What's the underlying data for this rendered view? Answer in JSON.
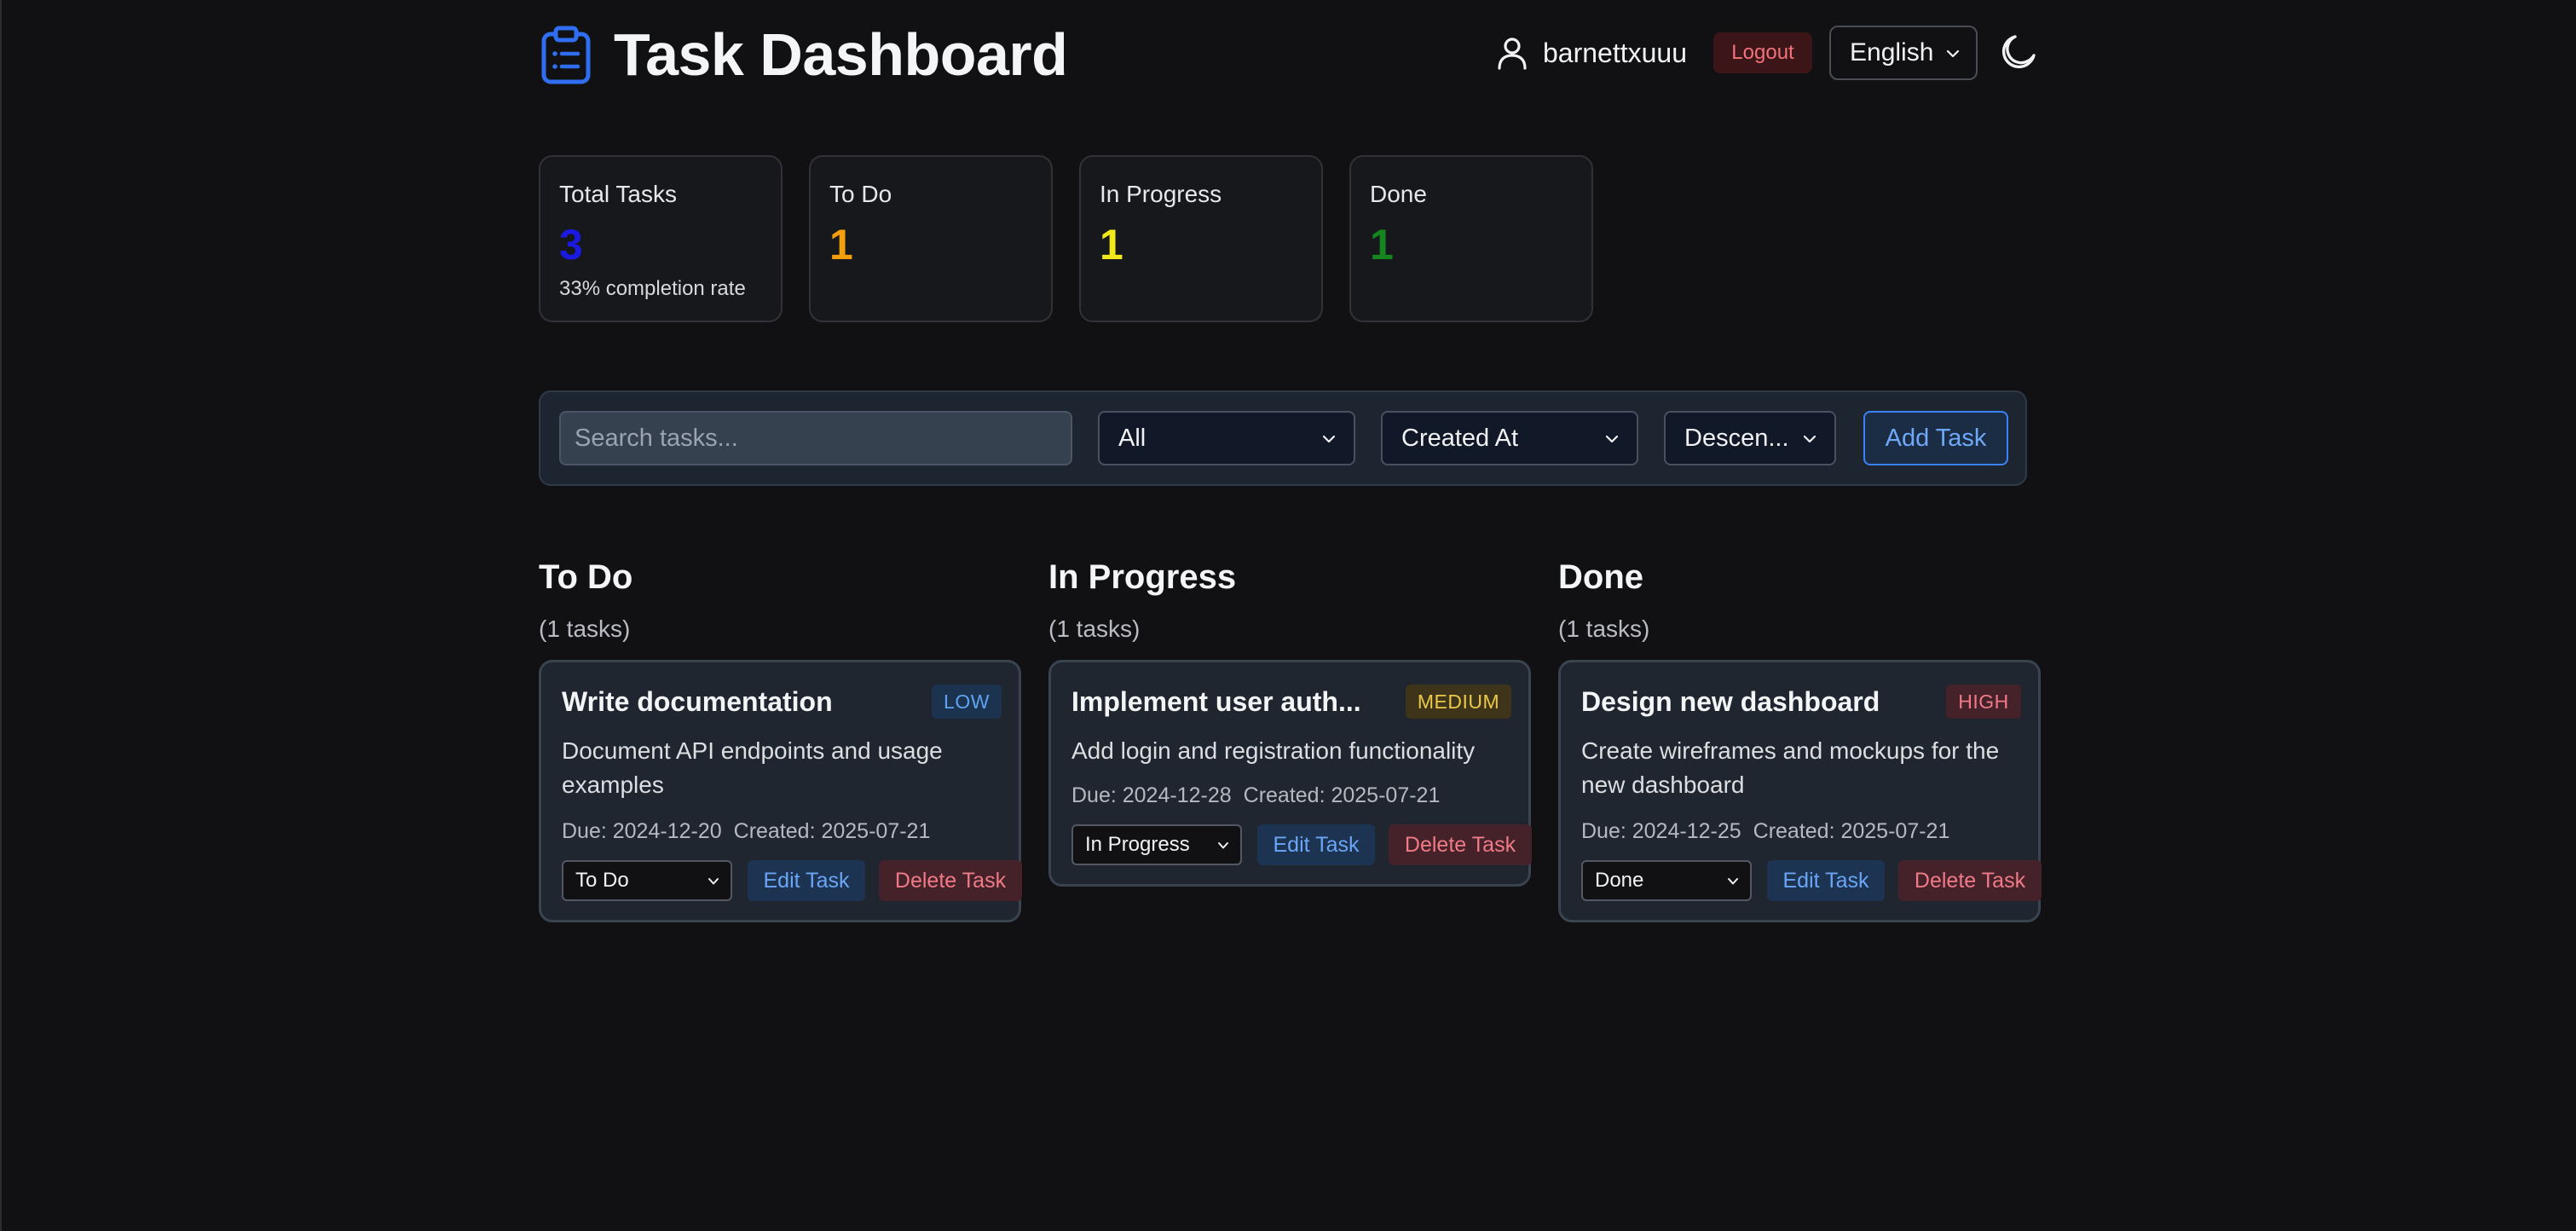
{
  "header": {
    "title": "Task Dashboard",
    "username": "barnettxuuu",
    "logout_label": "Logout",
    "language": "English",
    "logo_icon": "clipboard-list-icon",
    "user_icon": "user-icon",
    "theme_icon": "moon-icon"
  },
  "stats": [
    {
      "label": "Total Tasks",
      "value": "3",
      "sub": "33% completion rate",
      "color": "#1a1ae0"
    },
    {
      "label": "To Do",
      "value": "1",
      "color": "#f59e0b"
    },
    {
      "label": "In Progress",
      "value": "1",
      "color": "#f0e81a"
    },
    {
      "label": "Done",
      "value": "1",
      "color": "#15861f"
    }
  ],
  "toolbar": {
    "search_placeholder": "Search tasks...",
    "priority_filter": "All",
    "sort_by": "Created At",
    "sort_order": "Descen...",
    "add_label": "Add Task"
  },
  "columns": [
    {
      "title": "To Do",
      "count": "(1 tasks)",
      "card": {
        "title": "Write documentation",
        "priority": "LOW",
        "description": "Document API endpoints and usage examples",
        "due": "Due: 2024-12-20",
        "created": "Created: 2025-07-21",
        "status": "To Do",
        "edit_label": "Edit Task",
        "delete_label": "Delete Task"
      }
    },
    {
      "title": "In Progress",
      "count": "(1 tasks)",
      "card": {
        "title": "Implement user auth...",
        "priority": "MEDIUM",
        "description": "Add login and registration functionality",
        "due": "Due: 2024-12-28",
        "created": "Created: 2025-07-21",
        "status": "In Progress",
        "edit_label": "Edit Task",
        "delete_label": "Delete Task"
      }
    },
    {
      "title": "Done",
      "count": "(1 tasks)",
      "card": {
        "title": "Design new dashboard",
        "priority": "HIGH",
        "description": "Create wireframes and mockups for the new dashboard",
        "due": "Due: 2024-12-25",
        "created": "Created: 2025-07-21",
        "status": "Done",
        "edit_label": "Edit Task",
        "delete_label": "Delete Task"
      }
    }
  ],
  "colors": {
    "background": "#111113",
    "accent": "#3b82f6",
    "danger": "#f07a86"
  }
}
